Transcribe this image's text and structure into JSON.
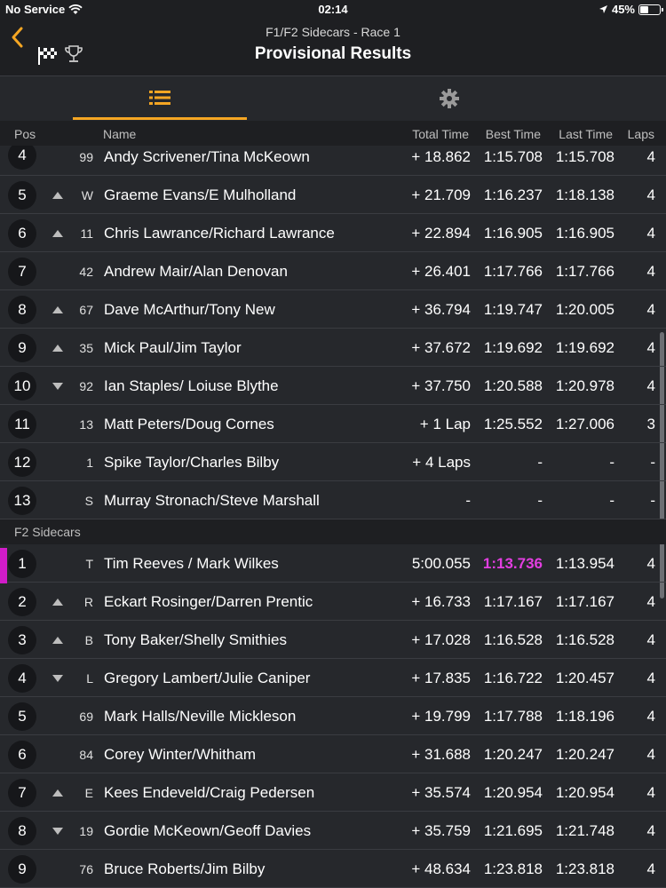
{
  "status": {
    "carrier": "No Service",
    "time": "02:14",
    "battery": "45%",
    "battery_level": 0.45
  },
  "nav": {
    "subtitle": "F1/F2 Sidecars - Race 1",
    "title": "Provisional Results"
  },
  "columns": {
    "pos": "Pos",
    "name": "Name",
    "total": "Total Time",
    "best": "Best Time",
    "last": "Last Time",
    "laps": "Laps"
  },
  "f1_rows": [
    {
      "pos": "4",
      "trend": "",
      "num": "99",
      "name": "Andy Scrivener/Tina McKeown",
      "total": "+ 18.862",
      "best": "1:15.708",
      "last": "1:15.708",
      "laps": "4"
    },
    {
      "pos": "5",
      "trend": "up",
      "num": "W",
      "name": "Graeme Evans/E Mulholland",
      "total": "+ 21.709",
      "best": "1:16.237",
      "last": "1:18.138",
      "laps": "4"
    },
    {
      "pos": "6",
      "trend": "up",
      "num": "11",
      "name": "Chris Lawrance/Richard Lawrance",
      "total": "+ 22.894",
      "best": "1:16.905",
      "last": "1:16.905",
      "laps": "4"
    },
    {
      "pos": "7",
      "trend": "",
      "num": "42",
      "name": "Andrew Mair/Alan Denovan",
      "total": "+ 26.401",
      "best": "1:17.766",
      "last": "1:17.766",
      "laps": "4"
    },
    {
      "pos": "8",
      "trend": "up",
      "num": "67",
      "name": "Dave McArthur/Tony New",
      "total": "+ 36.794",
      "best": "1:19.747",
      "last": "1:20.005",
      "laps": "4"
    },
    {
      "pos": "9",
      "trend": "up",
      "num": "35",
      "name": "Mick Paul/Jim Taylor",
      "total": "+ 37.672",
      "best": "1:19.692",
      "last": "1:19.692",
      "laps": "4"
    },
    {
      "pos": "10",
      "trend": "down",
      "num": "92",
      "name": "Ian Staples/ Loiuse Blythe",
      "total": "+ 37.750",
      "best": "1:20.588",
      "last": "1:20.978",
      "laps": "4"
    },
    {
      "pos": "11",
      "trend": "",
      "num": "13",
      "name": "Matt Peters/Doug Cornes",
      "total": "+ 1 Lap",
      "best": "1:25.552",
      "last": "1:27.006",
      "laps": "3"
    },
    {
      "pos": "12",
      "trend": "",
      "num": "1",
      "name": "Spike Taylor/Charles Bilby",
      "total": "+ 4 Laps",
      "best": "-",
      "last": "-",
      "laps": "-"
    },
    {
      "pos": "13",
      "trend": "",
      "num": "S",
      "name": "Murray Stronach/Steve Marshall",
      "total": "-",
      "best": "-",
      "last": "-",
      "laps": "-"
    }
  ],
  "f2_section": "F2 Sidecars",
  "f2_rows": [
    {
      "pos": "1",
      "trend": "",
      "num": "T",
      "name": "Tim Reeves / Mark Wilkes",
      "total": "5:00.055",
      "best": "1:13.736",
      "last": "1:13.954",
      "laps": "4",
      "leader": true
    },
    {
      "pos": "2",
      "trend": "up",
      "num": "R",
      "name": "Eckart Rosinger/Darren Prentic",
      "total": "+ 16.733",
      "best": "1:17.167",
      "last": "1:17.167",
      "laps": "4"
    },
    {
      "pos": "3",
      "trend": "up",
      "num": "B",
      "name": "Tony Baker/Shelly Smithies",
      "total": "+ 17.028",
      "best": "1:16.528",
      "last": "1:16.528",
      "laps": "4"
    },
    {
      "pos": "4",
      "trend": "down",
      "num": "L",
      "name": "Gregory Lambert/Julie Caniper",
      "total": "+ 17.835",
      "best": "1:16.722",
      "last": "1:20.457",
      "laps": "4"
    },
    {
      "pos": "5",
      "trend": "",
      "num": "69",
      "name": "Mark Halls/Neville Mickleson",
      "total": "+ 19.799",
      "best": "1:17.788",
      "last": "1:18.196",
      "laps": "4"
    },
    {
      "pos": "6",
      "trend": "",
      "num": "84",
      "name": "Corey Winter/Whitham",
      "total": "+ 31.688",
      "best": "1:20.247",
      "last": "1:20.247",
      "laps": "4"
    },
    {
      "pos": "7",
      "trend": "up",
      "num": "E",
      "name": "Kees Endeveld/Craig Pedersen",
      "total": "+ 35.574",
      "best": "1:20.954",
      "last": "1:20.954",
      "laps": "4"
    },
    {
      "pos": "8",
      "trend": "down",
      "num": "19",
      "name": "Gordie McKeown/Geoff Davies",
      "total": "+ 35.759",
      "best": "1:21.695",
      "last": "1:21.748",
      "laps": "4"
    },
    {
      "pos": "9",
      "trend": "",
      "num": "76",
      "name": "Bruce Roberts/Jim Bilby",
      "total": "+ 48.634",
      "best": "1:23.818",
      "last": "1:23.818",
      "laps": "4"
    }
  ],
  "colors": {
    "accent": "#f5a623",
    "leader": "#d11cc9",
    "best_lap": "#e23ee0"
  },
  "icons": {
    "back": "chevron-left-icon",
    "flag": "checkered-flag-icon",
    "trophy": "trophy-icon",
    "list": "list-icon",
    "settings": "gear-icon"
  }
}
